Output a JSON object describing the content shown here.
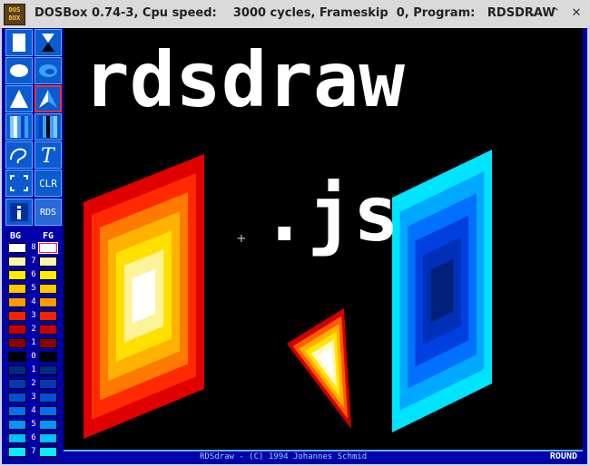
{
  "window": {
    "icon_line1": "DOS",
    "icon_line2": "BOX",
    "title": "DOSBox 0.74-3, Cpu speed:    3000 cycles, Frameskip  0, Program:   RDSDRAW",
    "minimize": "⌄",
    "maximize": "⌃",
    "close": "✕"
  },
  "tools": [
    {
      "name": "rectangle-tool-icon",
      "active": false
    },
    {
      "name": "hourglass-tool-icon",
      "active": false
    },
    {
      "name": "ellipse-tool-icon",
      "active": false
    },
    {
      "name": "filled-ellipse-tool-icon",
      "active": false
    },
    {
      "name": "triangle-tool-icon",
      "active": false
    },
    {
      "name": "arrow-triangle-tool-icon",
      "active": true
    },
    {
      "name": "gradient-bar-tool-icon",
      "active": false
    },
    {
      "name": "gradient-bar-dark-tool-icon",
      "active": false
    },
    {
      "name": "curve-tool-icon",
      "active": false
    },
    {
      "name": "text-tool-icon",
      "active": false
    },
    {
      "name": "selection-tool-icon",
      "active": false
    },
    {
      "name": "clear-tool-icon",
      "active": false,
      "label": "CLR"
    },
    {
      "name": "info-tool-icon",
      "active": false,
      "label": "i"
    },
    {
      "name": "rds-logo-icon",
      "active": false,
      "label": "RDS"
    }
  ],
  "palette": {
    "bg_label": "BG",
    "fg_label": "FG",
    "rows": [
      {
        "num": "8",
        "bg": "#ffffff",
        "fg": "#ffffff"
      },
      {
        "num": "7",
        "bg": "#fff4b0",
        "fg": "#fff4b0"
      },
      {
        "num": "6",
        "bg": "#ffee00",
        "fg": "#ffee00"
      },
      {
        "num": "5",
        "bg": "#ffc800",
        "fg": "#ffc800"
      },
      {
        "num": "4",
        "bg": "#ff9a00",
        "fg": "#ff9a00"
      },
      {
        "num": "3",
        "bg": "#ff2000",
        "fg": "#ff2000"
      },
      {
        "num": "2",
        "bg": "#c80000",
        "fg": "#c80000"
      },
      {
        "num": "1",
        "bg": "#8a0000",
        "fg": "#8a0000"
      },
      {
        "num": "0",
        "bg": "#000000",
        "fg": "#000000"
      },
      {
        "num": "1",
        "bg": "#002a80",
        "fg": "#002a80"
      },
      {
        "num": "2",
        "bg": "#003ab0",
        "fg": "#003ab0"
      },
      {
        "num": "3",
        "bg": "#0050d8",
        "fg": "#0050d8"
      },
      {
        "num": "4",
        "bg": "#0070f0",
        "fg": "#0070f0"
      },
      {
        "num": "5",
        "bg": "#0096ff",
        "fg": "#0096ff"
      },
      {
        "num": "6",
        "bg": "#00c0ff",
        "fg": "#00c0ff"
      },
      {
        "num": "7",
        "bg": "#00f0ff",
        "fg": "#00f0ff"
      }
    ],
    "selected_fg": "8"
  },
  "canvas": {
    "title": "rdsdraw",
    "subtitle": ".js",
    "cursor": "+"
  },
  "status": {
    "text": "RDSdraw - (C) 1994 Johannes Schmid",
    "mode": "ROUND"
  },
  "colors": {
    "warm": [
      "#e00000",
      "#ff2a00",
      "#ff7a00",
      "#ffb300",
      "#ffe000",
      "#fff39a",
      "#ffffff"
    ],
    "cool": [
      "#00e4ff",
      "#00a8ff",
      "#0070ff",
      "#0040e0",
      "#0030b8",
      "#00207a"
    ]
  }
}
